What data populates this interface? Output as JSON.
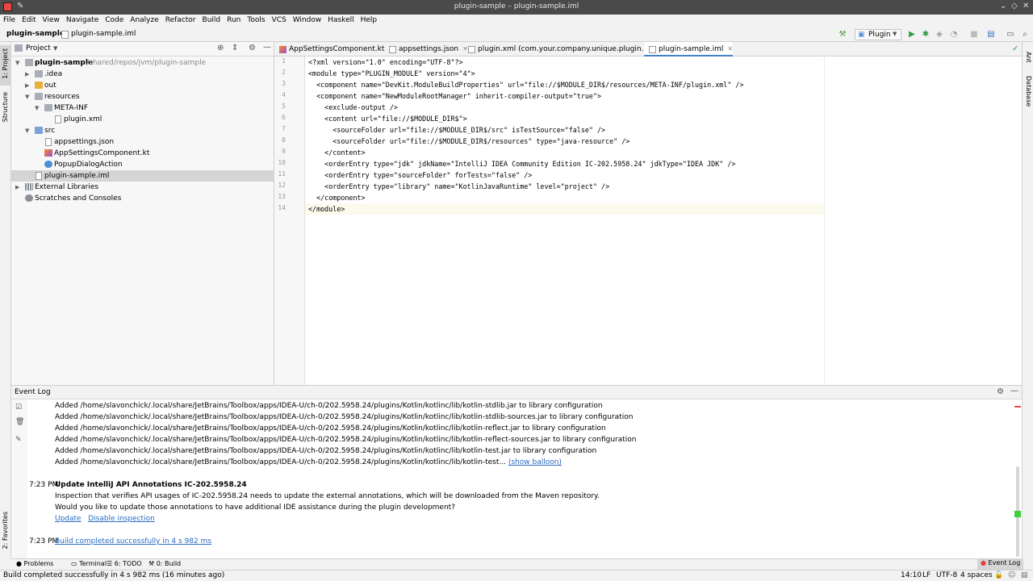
{
  "window": {
    "title": "plugin-sample – plugin-sample.iml"
  },
  "menu": [
    "File",
    "Edit",
    "View",
    "Navigate",
    "Code",
    "Analyze",
    "Refactor",
    "Build",
    "Run",
    "Tools",
    "VCS",
    "Window",
    "Haskell",
    "Help"
  ],
  "breadcrumb": {
    "project": "plugin-sample",
    "file": "plugin-sample.iml"
  },
  "run_config": {
    "label": "Plugin"
  },
  "left_strip": {
    "project": "1: Project",
    "structure": "Structure",
    "favorites": "2: Favorites"
  },
  "right_strip": {
    "ant": "Ant",
    "database": "Database"
  },
  "project_panel": {
    "title": "Project",
    "tree": [
      {
        "name": "plugin-sample",
        "extra": "/shared/repos/jvm/plugin-sample"
      },
      {
        "name": ".idea"
      },
      {
        "name": "out"
      },
      {
        "name": "resources"
      },
      {
        "name": "META-INF"
      },
      {
        "name": "plugin.xml"
      },
      {
        "name": "src"
      },
      {
        "name": "appsettings.json"
      },
      {
        "name": "AppSettingsComponent.kt"
      },
      {
        "name": "PopupDialogAction"
      },
      {
        "name": "plugin-sample.iml"
      },
      {
        "name": "External Libraries"
      },
      {
        "name": "Scratches and Consoles"
      }
    ]
  },
  "editor_tabs": [
    {
      "label": "AppSettingsComponent.kt"
    },
    {
      "label": "appsettings.json"
    },
    {
      "label": "plugin.xml (com.your.company.unique.plugin.id)"
    },
    {
      "label": "plugin-sample.iml"
    }
  ],
  "code": {
    "line_numbers": [
      "1",
      "2",
      "3",
      "4",
      "5",
      "6",
      "7",
      "8",
      "9",
      "10",
      "11",
      "12",
      "13",
      "14"
    ],
    "lines": [
      "<?xml version=\"1.0\" encoding=\"UTF-8\"?>",
      "<module type=\"PLUGIN_MODULE\" version=\"4\">",
      "  <component name=\"DevKit.ModuleBuildProperties\" url=\"file://$MODULE_DIR$/resources/META-INF/plugin.xml\" />",
      "  <component name=\"NewModuleRootManager\" inherit-compiler-output=\"true\">",
      "    <exclude-output />",
      "    <content url=\"file://$MODULE_DIR$\">",
      "      <sourceFolder url=\"file://$MODULE_DIR$/src\" isTestSource=\"false\" />",
      "      <sourceFolder url=\"file://$MODULE_DIR$/resources\" type=\"java-resource\" />",
      "    </content>",
      "    <orderEntry type=\"jdk\" jdkName=\"IntelliJ IDEA Community Edition IC-202.5958.24\" jdkType=\"IDEA JDK\" />",
      "    <orderEntry type=\"sourceFolder\" forTests=\"false\" />",
      "    <orderEntry type=\"library\" name=\"KotlinJavaRuntime\" level=\"project\" />",
      "  </component>",
      "</module>"
    ]
  },
  "event_log": {
    "title": "Event Log",
    "added_lines": [
      "Added /home/slavonchick/.local/share/JetBrains/Toolbox/apps/IDEA-U/ch-0/202.5958.24/plugins/Kotlin/kotlinc/lib/kotlin-stdlib.jar to library configuration",
      "Added /home/slavonchick/.local/share/JetBrains/Toolbox/apps/IDEA-U/ch-0/202.5958.24/plugins/Kotlin/kotlinc/lib/kotlin-stdlib-sources.jar to library configuration",
      "Added /home/slavonchick/.local/share/JetBrains/Toolbox/apps/IDEA-U/ch-0/202.5958.24/plugins/Kotlin/kotlinc/lib/kotlin-reflect.jar to library configuration",
      "Added /home/slavonchick/.local/share/JetBrains/Toolbox/apps/IDEA-U/ch-0/202.5958.24/plugins/Kotlin/kotlinc/lib/kotlin-reflect-sources.jar to library configuration",
      "Added /home/slavonchick/.local/share/JetBrains/Toolbox/apps/IDEA-U/ch-0/202.5958.24/plugins/Kotlin/kotlinc/lib/kotlin-test.jar to library configuration"
    ],
    "last_added": "Added /home/slavonchick/.local/share/JetBrains/Toolbox/apps/IDEA-U/ch-0/202.5958.24/plugins/Kotlin/kotlinc/lib/kotlin-test...",
    "show_balloon": "(show balloon)",
    "entry1": {
      "time": "7:23 PM",
      "title": "Update IntelliJ API Annotations IC-202.5958.24",
      "line1": "Inspection that verifies API usages of IC-202.5958.24 needs to update the external annotations, which will be downloaded from the Maven repository.",
      "line2": "Would you like to update those annotations to have additional IDE assistance during the plugin development?",
      "update": "Update",
      "disable": "Disable inspection"
    },
    "entry2": {
      "time": "7:23 PM",
      "text": "Build completed successfully in 4 s 982 ms"
    }
  },
  "bottom_tabs": {
    "problems": "Problems",
    "terminal": "Terminal",
    "todo": "6: TODO",
    "build": "0: Build",
    "event_log": "Event Log"
  },
  "status": {
    "message": "Build completed successfully in 4 s 982 ms (16 minutes ago)",
    "position": "14:10",
    "line_sep": "LF",
    "encoding": "UTF-8",
    "indent": "4 spaces"
  }
}
